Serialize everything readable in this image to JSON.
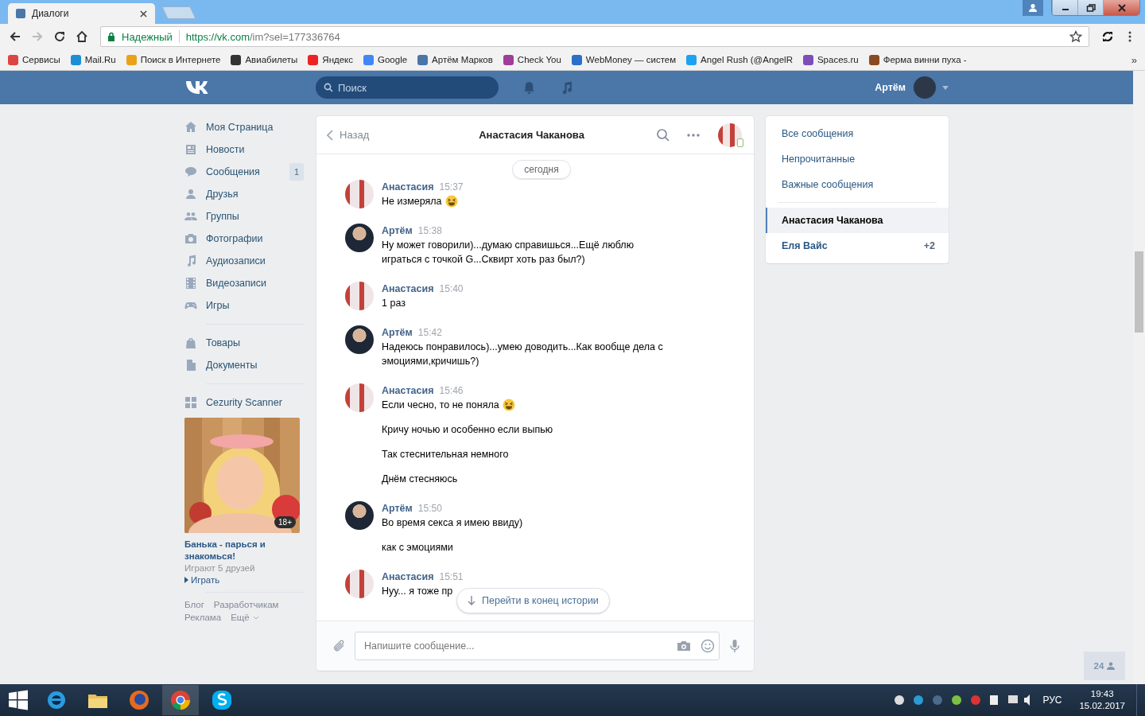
{
  "browser": {
    "tab_title": "Диалоги",
    "secure_label": "Надежный",
    "url_host": "https://vk.com",
    "url_path": "/im?sel=177336764",
    "bookmarks": [
      {
        "label": "Сервисы"
      },
      {
        "label": "Mail.Ru"
      },
      {
        "label": "Поиск в Интернете"
      },
      {
        "label": "Авиабилеты"
      },
      {
        "label": "Яндекс"
      },
      {
        "label": "Google"
      },
      {
        "label": "Артём Марков"
      },
      {
        "label": "Check You"
      },
      {
        "label": "WebMoney — систем"
      },
      {
        "label": "Angel Rush (@AngelR"
      },
      {
        "label": "Spaces.ru"
      },
      {
        "label": "Ферма винни пуха - "
      }
    ],
    "more": "»"
  },
  "header": {
    "search_placeholder": "Поиск",
    "user_name": "Артём"
  },
  "left_menu": {
    "groups": [
      {
        "items": [
          {
            "label": "Моя Страница"
          },
          {
            "label": "Новости"
          },
          {
            "label": "Сообщения",
            "badge": "1"
          },
          {
            "label": "Друзья"
          },
          {
            "label": "Группы"
          },
          {
            "label": "Фотографии"
          },
          {
            "label": "Аудиозаписи"
          },
          {
            "label": "Видеозаписи"
          },
          {
            "label": "Игры"
          }
        ]
      },
      {
        "items": [
          {
            "label": "Товары"
          },
          {
            "label": "Документы"
          }
        ]
      },
      {
        "items": [
          {
            "label": "Cezurity Scanner"
          }
        ]
      }
    ],
    "ad": {
      "age_badge": "18+",
      "title": "Банька - парься и знакомься!",
      "subtitle": "Играют 5 друзей",
      "action": "Играть"
    },
    "footer_links": [
      "Блог",
      "Разработчикам",
      "Реклама",
      "Ещё"
    ]
  },
  "chat": {
    "back": "Назад",
    "title": "Анастасия Чаканова",
    "date_divider": "сегодня",
    "messages": [
      {
        "author": "Анастасия",
        "time": "15:37",
        "self": false,
        "lines": [
          {
            "text": "Не измеряла",
            "emoji": true
          }
        ]
      },
      {
        "author": "Артём",
        "time": "15:38",
        "self": true,
        "lines": [
          {
            "text": "Ну может говорили)...думаю справишься...Ещё люблю играться с точкой G...Сквирт хоть раз был?)",
            "emoji": false
          }
        ]
      },
      {
        "author": "Анастасия",
        "time": "15:40",
        "self": false,
        "lines": [
          {
            "text": "1 раз",
            "emoji": false
          }
        ]
      },
      {
        "author": "Артём",
        "time": "15:42",
        "self": true,
        "lines": [
          {
            "text": "Надеюсь понравилось)...умею доводить...Как вообще дела с эмоциями,кричишь?)",
            "emoji": false
          }
        ]
      },
      {
        "author": "Анастасия",
        "time": "15:46",
        "self": false,
        "lines": [
          {
            "text": "Если чесно, то не поняла",
            "emoji": true
          },
          {
            "text": "Кричу ночью и особенно если выпью",
            "emoji": false
          },
          {
            "text": "Так стеснительная немного",
            "emoji": false
          },
          {
            "text": "Днём стесняюсь",
            "emoji": false
          }
        ]
      },
      {
        "author": "Артём",
        "time": "15:50",
        "self": true,
        "lines": [
          {
            "text": "Во время секса я имею ввиду)",
            "emoji": false
          },
          {
            "text": "как с эмоциями",
            "emoji": false
          }
        ]
      },
      {
        "author": "Анастасия",
        "time": "15:51",
        "self": false,
        "lines": [
          {
            "text": "Нуу... я тоже пр",
            "emoji": false
          }
        ]
      }
    ],
    "jump_button": "Перейти в конец истории",
    "composer_placeholder": "Напишите сообщение..."
  },
  "right_menu": {
    "filters": [
      {
        "label": "Все сообщения",
        "selected": false
      },
      {
        "label": "Непрочитанные",
        "selected": false
      },
      {
        "label": "Важные сообщения",
        "selected": false
      }
    ],
    "conversations": [
      {
        "name": "Анастасия Чаканова",
        "selected": true
      },
      {
        "name": "Еля Вайс",
        "selected": false,
        "count": "+2"
      }
    ]
  },
  "online_count": "24",
  "taskbar": {
    "language": "РУС",
    "time": "19:43",
    "date": "15.02.2017"
  }
}
